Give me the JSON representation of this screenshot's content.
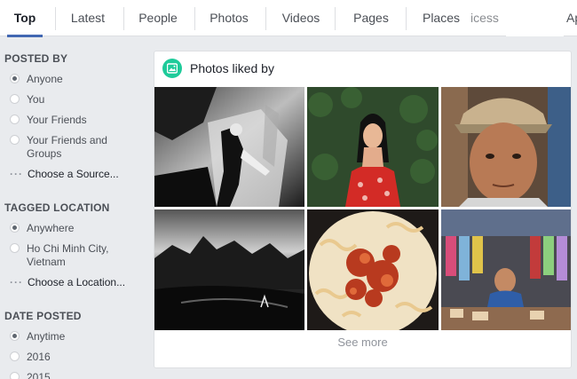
{
  "tabs": {
    "top": "Top",
    "latest": "Latest",
    "people": "People",
    "photos": "Photos",
    "videos": "Videos",
    "pages": "Pages",
    "places": "Places",
    "overflow_ghost": "icess",
    "overflow_cut": "Ap"
  },
  "filters": {
    "posted_by": {
      "heading": "POSTED BY",
      "options": [
        "Anyone",
        "You",
        "Your Friends",
        "Your Friends and Groups"
      ],
      "selected": "Anyone",
      "choose": "Choose a Source..."
    },
    "tagged_location": {
      "heading": "TAGGED LOCATION",
      "options": [
        "Anywhere",
        "Ho Chi Minh City, Vietnam"
      ],
      "selected": "Anywhere",
      "choose": "Choose a Location..."
    },
    "date_posted": {
      "heading": "DATE POSTED",
      "options": [
        "Anytime",
        "2016",
        "2015"
      ],
      "selected": "Anytime"
    }
  },
  "card": {
    "title": "Photos liked by",
    "icon": "photo-icon",
    "see_more": "See more"
  },
  "photos": [
    {
      "name": "photo-bw-mannequin",
      "subject": "black and white mannequin"
    },
    {
      "name": "photo-woman-red-dress",
      "subject": "woman in red dress"
    },
    {
      "name": "photo-man-cap-portrait",
      "subject": "man wearing cap portrait"
    },
    {
      "name": "photo-bw-landscape",
      "subject": "black and white landscape"
    },
    {
      "name": "photo-pasta-dish",
      "subject": "pasta dish"
    },
    {
      "name": "photo-market-stall",
      "subject": "market stall"
    }
  ],
  "colors": {
    "accent": "#4267b2",
    "icon_bg": "#1ecb9a",
    "page_bg": "#e9ebee"
  }
}
